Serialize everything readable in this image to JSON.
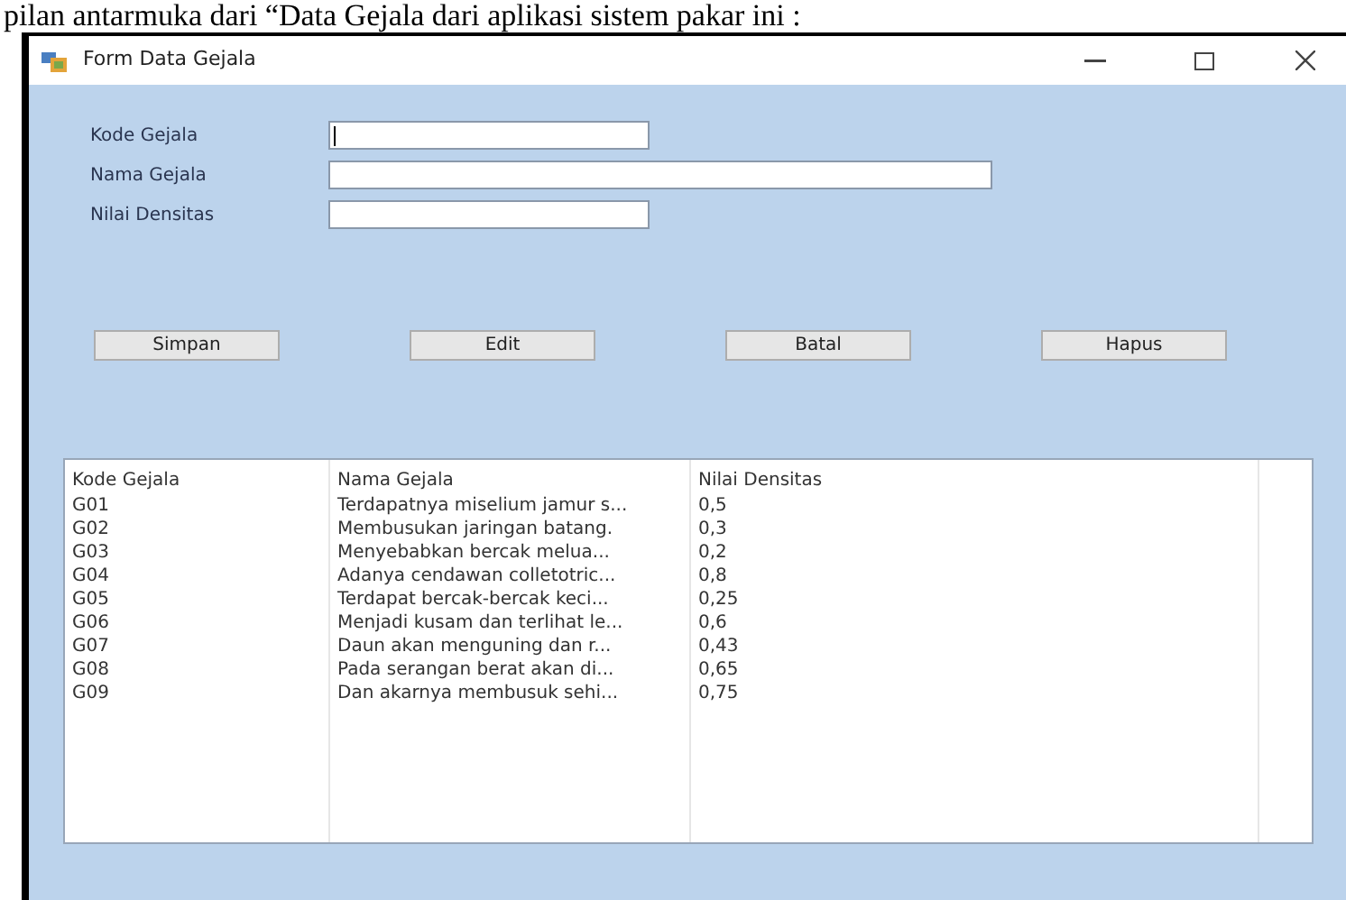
{
  "caption": "pilan antarmuka dari “Data Gejala dari aplikasi sistem pakar ini :",
  "window": {
    "title": "Form Data Gejala"
  },
  "fields": [
    {
      "label": "Kode Gejala",
      "kind": "short",
      "focused": true
    },
    {
      "label": "Nama Gejala",
      "kind": "long",
      "focused": false
    },
    {
      "label": "Nilai Densitas",
      "kind": "short",
      "focused": false
    }
  ],
  "buttons": [
    "Simpan",
    "Edit",
    "Batal",
    "Hapus"
  ],
  "table": {
    "columns": [
      "Kode Gejala",
      "Nama Gejala",
      "Nilai Densitas"
    ],
    "rows": [
      [
        "G01",
        "Terdapatnya miselium jamur s...",
        "0,5"
      ],
      [
        "G02",
        "Membusukan jaringan batang.",
        "0,3"
      ],
      [
        "G03",
        "Menyebabkan bercak melua...",
        "0,2"
      ],
      [
        "G04",
        "Adanya cendawan colletotric...",
        "0,8"
      ],
      [
        "G05",
        "Terdapat bercak-bercak keci...",
        "0,25"
      ],
      [
        "G06",
        "Menjadi kusam dan terlihat le...",
        "0,6"
      ],
      [
        "G07",
        "Daun akan menguning dan r...",
        "0,43"
      ],
      [
        "G08",
        "Pada serangan berat akan di...",
        "0,65"
      ],
      [
        "G09",
        "Dan akarnya membusuk sehi...",
        "0,75"
      ]
    ]
  }
}
